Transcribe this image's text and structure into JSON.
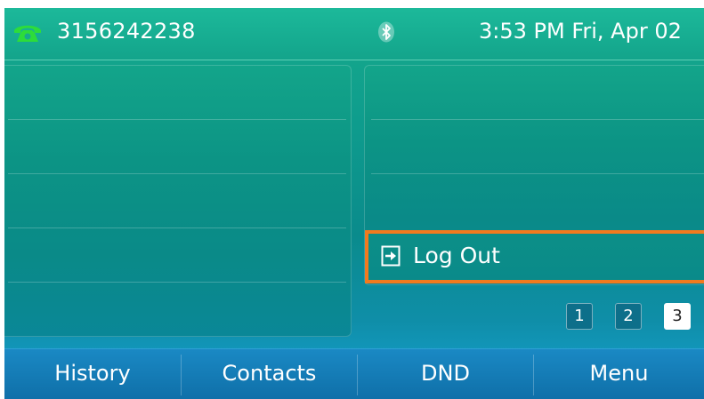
{
  "status_bar": {
    "phone_number": "3156242238",
    "datetime": "3:53 PM Fri, Apr 02",
    "icons": [
      "phone-icon",
      "bluetooth-icon"
    ]
  },
  "line_keys": {
    "logout_label": "Log Out",
    "logout_icon": "logout-icon"
  },
  "pages": {
    "buttons": [
      "1",
      "2",
      "3"
    ],
    "active": "3"
  },
  "softkeys": [
    "History",
    "Contacts",
    "DND",
    "Menu"
  ],
  "colors": {
    "highlight_border": "#f27a1e",
    "status_bar": "#17ab8c",
    "softkey_bar": "#1579b5",
    "phone_icon": "#2ddc3a"
  }
}
